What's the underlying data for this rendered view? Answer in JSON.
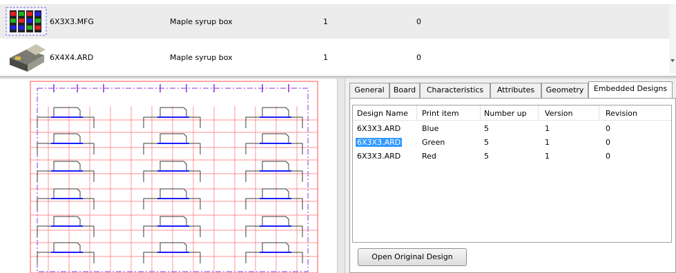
{
  "file_list": {
    "rows": [
      {
        "name": "6X3X3.MFG",
        "description": "Maple syrup box",
        "quantity": "1",
        "value": "0",
        "thumbnail_icon": "layout-thumbnail-icon"
      },
      {
        "name": "6X4X4.ARD",
        "description": "Maple syrup box",
        "quantity": "1",
        "value": "0",
        "thumbnail_icon": "box-thumbnail-icon"
      }
    ]
  },
  "properties": {
    "tabs": [
      "General",
      "Board",
      "Characteristics",
      "Attributes",
      "Geometry",
      "Embedded Designs"
    ],
    "active_tab": "Embedded Designs",
    "columns": [
      "Design Name",
      "Print item",
      "Number up",
      "Version",
      "Revision"
    ],
    "rows": [
      {
        "design_name": "6X3X3.ARD",
        "print_item": "Blue",
        "number_up": "5",
        "version": "1",
        "revision": "0",
        "selected": false
      },
      {
        "design_name": "6X3X3.ARD",
        "print_item": "Green",
        "number_up": "5",
        "version": "1",
        "revision": "0",
        "selected": true
      },
      {
        "design_name": "6X3X3.ARD",
        "print_item": "Red",
        "number_up": "5",
        "version": "1",
        "revision": "0",
        "selected": false
      }
    ],
    "open_button_label": "Open Original Design"
  },
  "colors": {
    "selection": "#3399ff",
    "die_line_red": "#ff6b6b",
    "die_line_dark": "#3a3a3a",
    "crease_blue": "#1a1aff",
    "border_purple": "#8a2be2"
  }
}
